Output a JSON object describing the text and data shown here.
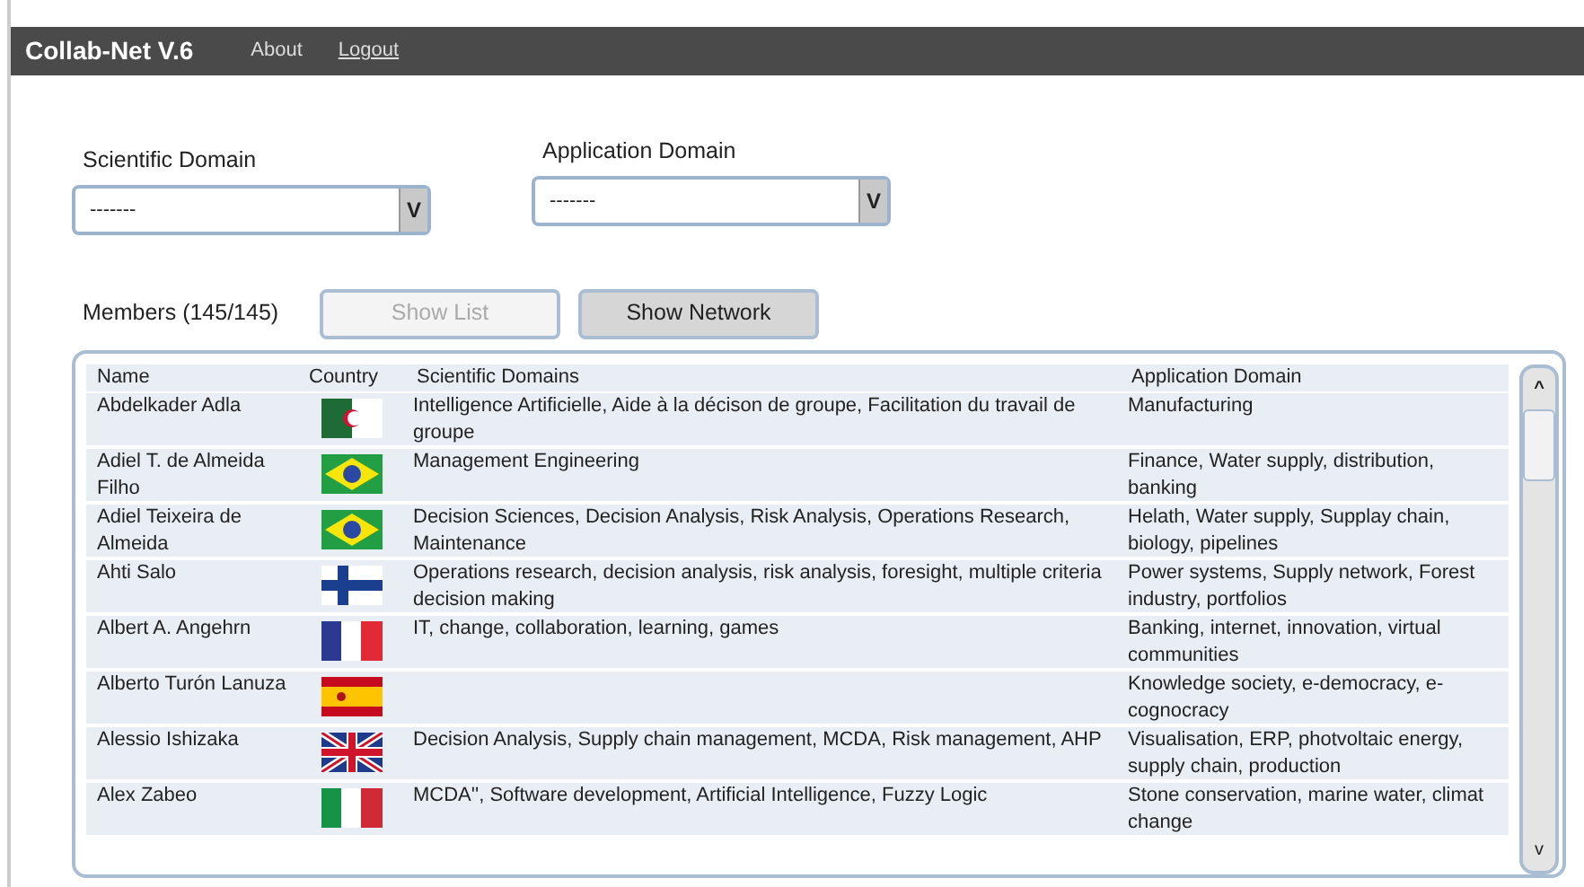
{
  "navbar": {
    "brand": "Collab-Net V.6",
    "links": [
      {
        "label": "About",
        "underlined": false
      },
      {
        "label": "Logout",
        "underlined": true
      }
    ]
  },
  "filters": [
    {
      "label": "Scientific Domain",
      "value": "-------",
      "toggle": "V"
    },
    {
      "label": "Application Domain",
      "value": "-------",
      "toggle": "V"
    }
  ],
  "members": {
    "label": "Members (145/145)"
  },
  "buttons": [
    {
      "label": "Show List",
      "disabled": true
    },
    {
      "label": "Show Network",
      "disabled": false
    }
  ],
  "table": {
    "columns": [
      "Name",
      "Country",
      "Scientific Domains",
      "Application Domain"
    ],
    "rows": [
      {
        "name": "Abdelkader Adla",
        "kind": "algeria",
        "scientific": "Intelligence Artificielle, Aide à la décison de groupe, Facilitation du travail de groupe",
        "application": "Manufacturing"
      },
      {
        "name": "Adiel T. de Almeida Filho",
        "kind": "brazil",
        "scientific": "Management Engineering",
        "application": "Finance, Water supply, distribution, banking"
      },
      {
        "name": "Adiel Teixeira de Almeida",
        "kind": "brazil",
        "scientific": "Decision Sciences, Decision Analysis, Risk Analysis, Operations Research, Maintenance",
        "application": "Helath, Water supply, Supplay chain, biology, pipelines"
      },
      {
        "name": "Ahti Salo",
        "kind": "finland",
        "scientific": "Operations research, decision analysis, risk analysis, foresight, multiple criteria decision making",
        "application": "Power systems, Supply network, Forest industry, portfolios"
      },
      {
        "name": "Albert A. Angehrn",
        "kind": "france",
        "scientific": "IT, change, collaboration, learning, games",
        "application": "Banking, internet, innovation, virtual communities"
      },
      {
        "name": "Alberto Turón Lanuza",
        "kind": "spain",
        "application": "Knowledge society, e-democracy, e-cognocracy"
      },
      {
        "name": "Alessio Ishizaka",
        "kind": "uk",
        "scientific": "Decision Analysis, Supply chain management, MCDA, Risk management, AHP",
        "application": "Visualisation, ERP, photvoltaic energy, supply chain, production"
      },
      {
        "name": "Alex Zabeo",
        "kind": "italy",
        "scientific": "MCDA'', Software development, Artificial Intelligence, Fuzzy Logic",
        "application": "Stone conservation, marine water, climat change"
      }
    ]
  },
  "scrollbar": {
    "up": "^",
    "down": "v"
  }
}
